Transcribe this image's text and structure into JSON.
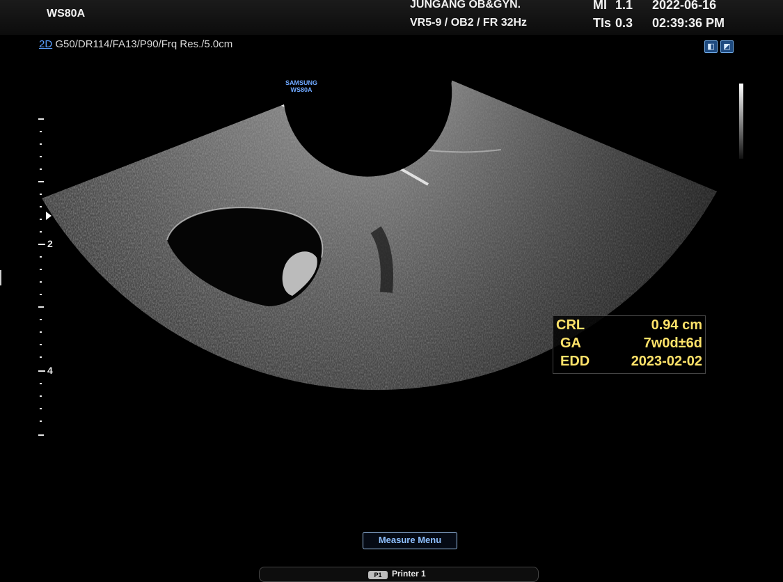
{
  "header": {
    "model": "WS80A",
    "institution": "JUNGANG OB&GYN.",
    "preset": "VR5-9 / OB2 / FR 32Hz",
    "mi_label": "MI",
    "mi_value": "1.1",
    "tis_label": "TIs",
    "tis_value": "0.3",
    "date": "2022-06-16",
    "time": "02:39:36 PM"
  },
  "params": {
    "mode": "2D",
    "gain": "G50",
    "dr": "DR114",
    "fa": "FA13",
    "p": "P90",
    "frq": "Frq Res.",
    "depth": "5.0cm"
  },
  "icons": [
    "probe-status-icon",
    "mode-indicator-icon"
  ],
  "brand": {
    "line1": "SAMSUNG",
    "line2": "WS80A"
  },
  "ruler": {
    "labels": [
      "2",
      "4"
    ]
  },
  "measurements": [
    {
      "label": "CRL",
      "value": "0.94 cm"
    },
    {
      "label": "GA",
      "value": "7w0d±6d"
    },
    {
      "label": "EDD",
      "value": "2023-02-02"
    }
  ],
  "footer": {
    "measure_menu": "Measure Menu",
    "printer_label": "Printer 1",
    "printer_badge": "P1"
  }
}
